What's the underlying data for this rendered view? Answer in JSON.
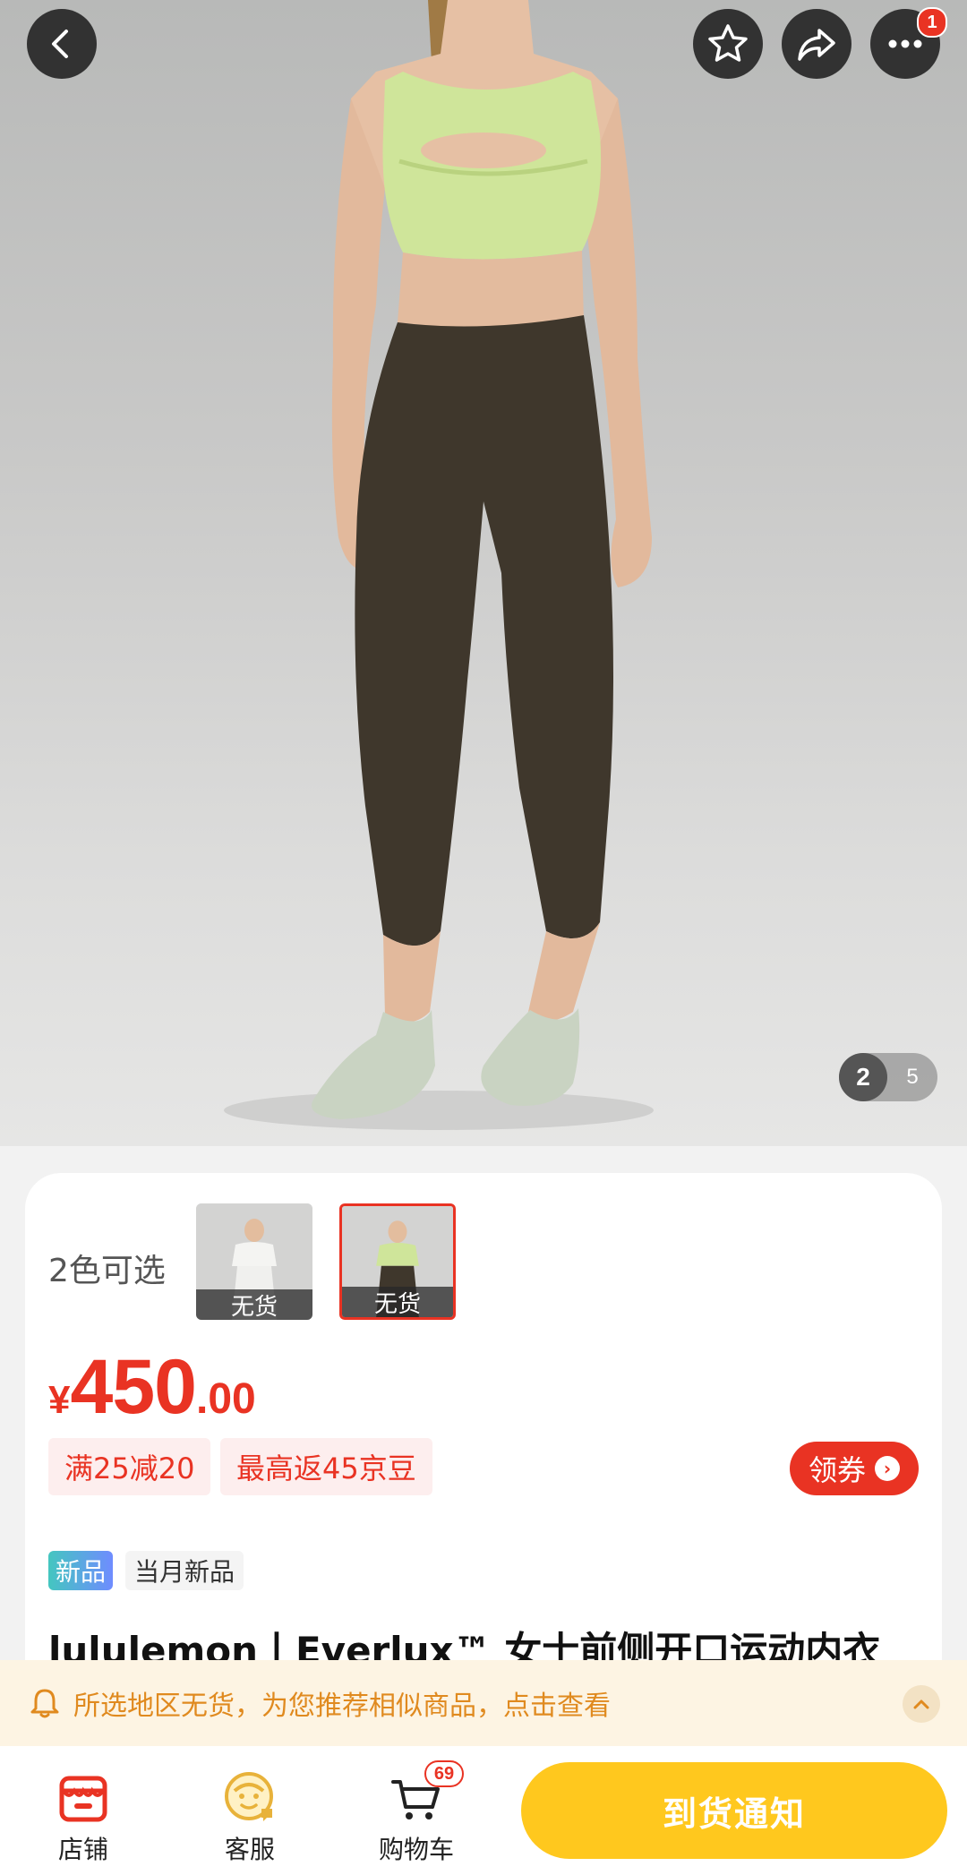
{
  "gallery": {
    "current_index": "2",
    "total": "5",
    "favorite_icon": "star-icon",
    "share_icon": "share-icon",
    "more_icon": "more-icon",
    "more_badge": "1"
  },
  "product": {
    "colors_label": "2色可选",
    "swatches": [
      {
        "caption": "无货",
        "tone": "white"
      },
      {
        "caption": "无货",
        "tone": "green",
        "selected": true
      }
    ],
    "price": {
      "currency": "¥",
      "integer": "450",
      "decimal": ".00"
    },
    "promos": [
      "满25减20",
      "最高返45京豆"
    ],
    "coupon_label": "领券",
    "coupon_arrow": "›",
    "tag_new": "新品",
    "tag_month": "当月新品",
    "title": "lululemon丨Everlux™ 女士前侧开口运动内衣"
  },
  "notice": {
    "text": "所选地区无货，为您推荐相似商品，点击查看"
  },
  "bottom_bar": {
    "store_label": "店铺",
    "service_label": "客服",
    "cart_label": "购物车",
    "cart_badge": "69",
    "notify_label": "到货通知"
  },
  "colors": {
    "accent_red": "#e93323",
    "notify_yellow": "#ffc81e",
    "notice_orange": "#e08a1f"
  }
}
